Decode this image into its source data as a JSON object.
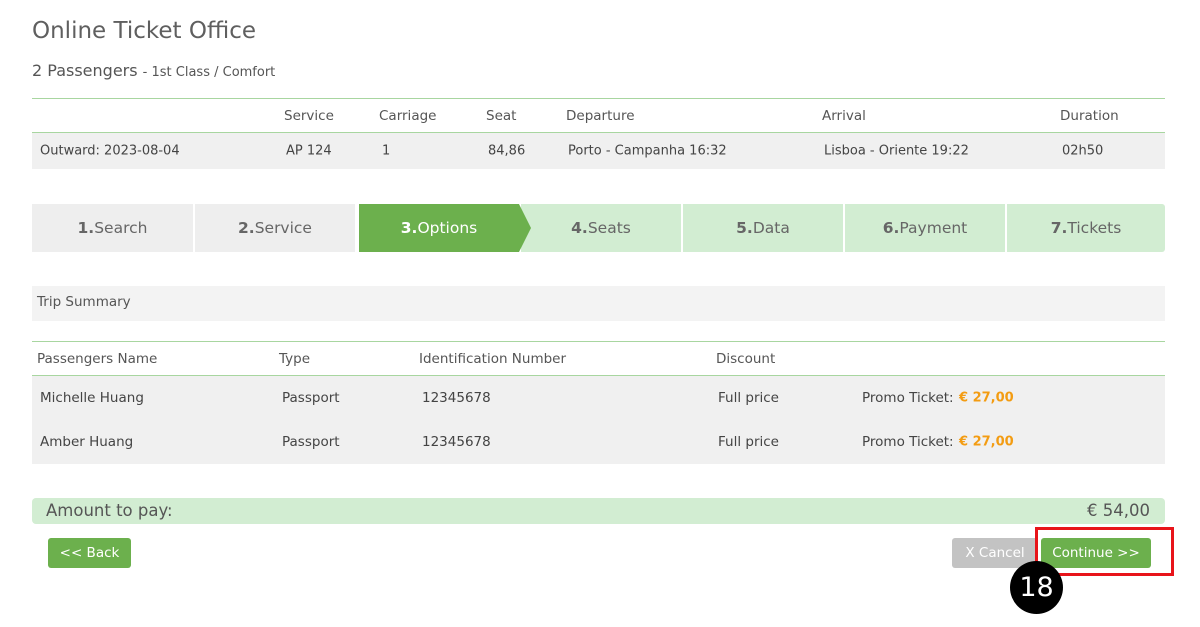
{
  "header": {
    "title": "Online Ticket Office",
    "passengers": "2 Passengers",
    "class_info": "- 1st Class / Comfort"
  },
  "itinerary": {
    "columns": [
      "",
      "Service",
      "Carriage",
      "Seat",
      "Departure",
      "Arrival",
      "Duration"
    ],
    "row": {
      "label": "Outward: 2023-08-04",
      "service": "AP 124",
      "carriage": "1",
      "seat": "84,86",
      "departure": "Porto - Campanha 16:32",
      "arrival": "Lisboa - Oriente 19:22",
      "duration": "02h50"
    }
  },
  "steps": [
    {
      "num": "1.",
      "label": "Search",
      "state": "done"
    },
    {
      "num": "2.",
      "label": "Service",
      "state": "done"
    },
    {
      "num": "3.",
      "label": "Options",
      "state": "active"
    },
    {
      "num": "4.",
      "label": "Seats",
      "state": "todo"
    },
    {
      "num": "5.",
      "label": "Data",
      "state": "todo"
    },
    {
      "num": "6.",
      "label": "Payment",
      "state": "todo"
    },
    {
      "num": "7.",
      "label": "Tickets",
      "state": "todo"
    }
  ],
  "summary": {
    "title": "Trip Summary",
    "columns": [
      "Passengers Name",
      "Type",
      "Identification Number",
      "Discount"
    ],
    "rows": [
      {
        "name": "Michelle Huang",
        "type": "Passport",
        "id": "12345678",
        "discount": "Full price",
        "ticket_label": "Promo Ticket:",
        "price": "€ 27,00"
      },
      {
        "name": "Amber Huang",
        "type": "Passport",
        "id": "12345678",
        "discount": "Full price",
        "ticket_label": "Promo Ticket:",
        "price": "€ 27,00"
      }
    ]
  },
  "amount": {
    "label": "Amount to pay:",
    "value": "€ 54,00"
  },
  "buttons": {
    "back": "<< Back",
    "cancel": "X Cancel",
    "continue": "Continue >>"
  },
  "annotation": {
    "step_number": "18"
  },
  "colors": {
    "accent": "#6cb04d",
    "light_accent": "#d2edd2",
    "price": "#f39c12",
    "highlight": "#e8141a"
  }
}
